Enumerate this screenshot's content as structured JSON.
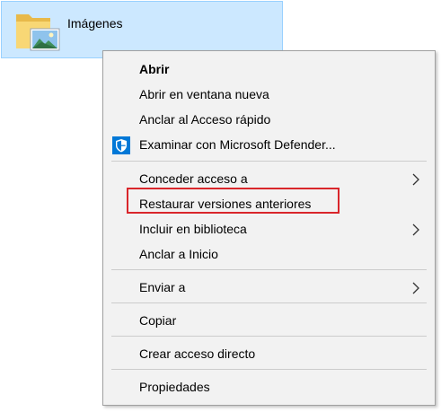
{
  "folder": {
    "name": "Imágenes",
    "icon": "pictures-folder-icon"
  },
  "menu": {
    "open": "Abrir",
    "open_new_window": "Abrir en ventana nueva",
    "pin_quick_access": "Anclar al Acceso rápido",
    "scan_defender": "Examinar con Microsoft Defender...",
    "grant_access": "Conceder acceso a",
    "restore_versions": "Restaurar versiones anteriores",
    "include_library": "Incluir en biblioteca",
    "pin_start": "Anclar a Inicio",
    "send_to": "Enviar a",
    "copy": "Copiar",
    "create_shortcut": "Crear acceso directo",
    "properties": "Propiedades"
  },
  "colors": {
    "selection_fill": "#cce8ff",
    "selection_border": "#99d1ff",
    "menu_background": "#f2f2f2",
    "highlight": "#d9262b",
    "defender_blue": "#0078d7"
  }
}
